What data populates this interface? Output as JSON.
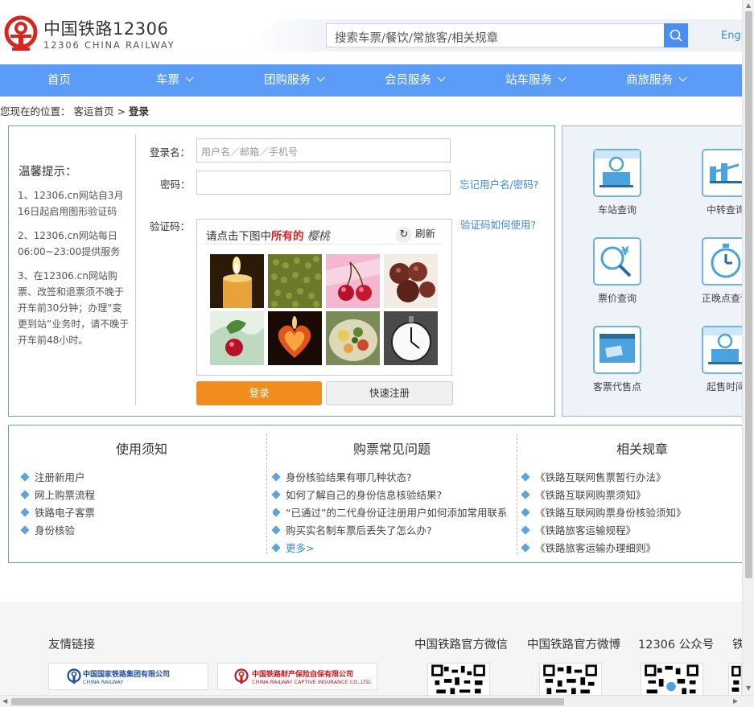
{
  "header": {
    "logo_cn": "中国铁路12306",
    "logo_en": "12306 CHINA RAILWAY",
    "search_placeholder": "搜索车票/餐饮/常旅客/相关规章",
    "lang": "English"
  },
  "nav": {
    "items": [
      {
        "label": "首页",
        "dropdown": false
      },
      {
        "label": "车票",
        "dropdown": true
      },
      {
        "label": "团购服务",
        "dropdown": true
      },
      {
        "label": "会员服务",
        "dropdown": true
      },
      {
        "label": "站车服务",
        "dropdown": true
      },
      {
        "label": "商旅服务",
        "dropdown": true
      }
    ]
  },
  "breadcrumb": {
    "prefix": "您现在的位置：",
    "parent": "客运首页",
    "sep": ">",
    "current": "登录"
  },
  "tips": {
    "title": "温馨提示：",
    "items": [
      "1、12306.cn网站自3月16日起启用图形验证码",
      "2、12306.cn网站每日06:00~23:00提供服务",
      "3、在12306.cn网站购票、改签和退票须不晚于开车前30分钟；办理“变更到站”业务时，请不晚于开车前48小时。"
    ]
  },
  "login": {
    "username_label": "登录名：",
    "username_placeholder": "用户名／邮箱／手机号",
    "password_label": "密码：",
    "password_value": "",
    "forgot_link": "忘记用户名/密码?",
    "captcha_label": "验证码：",
    "captcha_help_link": "验证码如何使用?",
    "captcha_prompt_prefix": "请点击下图中",
    "captcha_prompt_emph": "所有的",
    "captcha_prompt_word": "樱桃",
    "captcha_refresh": "刷新",
    "captcha_images": [
      "candle",
      "mung-beans",
      "cherries",
      "dried-fruit",
      "cherry-splash",
      "fire-heart",
      "salad",
      "clock"
    ],
    "login_button": "登录",
    "register_button": "快速注册"
  },
  "quick_services": [
    {
      "label": "车站查询",
      "icon": "station-icon"
    },
    {
      "label": "中转查询",
      "icon": "transfer-icon"
    },
    {
      "label": "票价查询",
      "icon": "price-icon"
    },
    {
      "label": "正晚点查询",
      "icon": "clock-icon"
    },
    {
      "label": "客票代售点",
      "icon": "agency-icon"
    },
    {
      "label": "起售时间",
      "icon": "train-time-icon"
    }
  ],
  "info": {
    "notice": {
      "title": "使用须知",
      "items": [
        "注册新用户",
        "网上购票流程",
        "铁路电子客票",
        "身份核验"
      ]
    },
    "faq": {
      "title": "购票常见问题",
      "items": [
        "身份核验结果有哪几种状态?",
        "如何了解自己的身份信息核验结果?",
        "“已通过”的二代身份证注册用户如何添加常用联系人",
        "购买实名制车票后丢失了怎么办?"
      ],
      "more": "更多>"
    },
    "rules": {
      "title": "相关规章",
      "items": [
        "《铁路互联网售票暂行办法》",
        "《铁路互联网购票须知》",
        "《铁路互联网购票身份核验须知》",
        "《铁路旅客运输规程》",
        "《铁路旅客运输办理细则》"
      ]
    }
  },
  "footer": {
    "links_title": "友情链接",
    "partners": [
      {
        "name": "中国国家铁路集团有限公司",
        "en": "CHINA RAILWAY"
      },
      {
        "name": "中国铁路财产保险自保有限公司",
        "en": "CHINA RAILWAY CAPTIVE INSURANCE CO.,LTD."
      }
    ],
    "qr_titles": [
      "中国铁路官方微信",
      "中国铁路官方微博",
      "12306 公众号",
      "铁"
    ]
  },
  "colors": {
    "nav_blue": "#5a9cf8",
    "login_orange": "#f18d1f",
    "link_blue": "#3b8bd8",
    "logo_red": "#d9261c"
  }
}
